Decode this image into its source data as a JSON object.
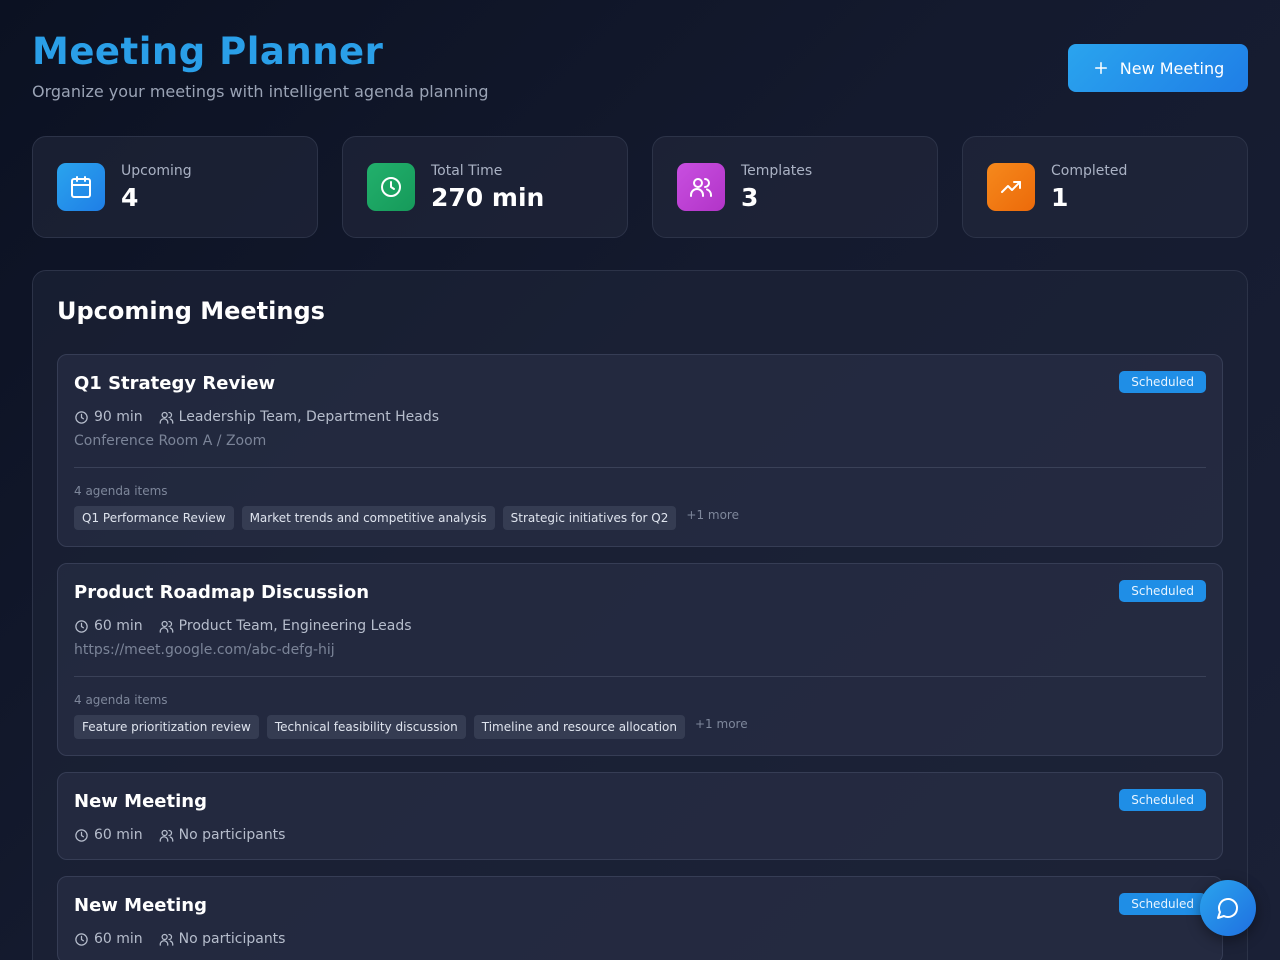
{
  "header": {
    "title": "Meeting Planner",
    "subtitle": "Organize your meetings with intelligent agenda planning",
    "new_button": "New Meeting"
  },
  "stats": [
    {
      "label": "Upcoming",
      "value": "4",
      "icon": "calendar-icon",
      "color": "#1f8fe8"
    },
    {
      "label": "Total Time",
      "value": "270 min",
      "icon": "clock-icon",
      "color": "#1ea866"
    },
    {
      "label": "Templates",
      "value": "3",
      "icon": "users-icon",
      "color": "#c044d8"
    },
    {
      "label": "Completed",
      "value": "1",
      "icon": "trending-up-icon",
      "color": "#f07a12"
    }
  ],
  "meetings_panel": {
    "title": "Upcoming Meetings",
    "meetings": [
      {
        "title": "Q1 Strategy Review",
        "status": "Scheduled",
        "duration": "90 min",
        "participants": "Leadership Team, Department Heads",
        "location": "Conference Room A / Zoom",
        "agenda_count": "4 agenda items",
        "agenda": [
          "Q1 Performance Review",
          "Market trends and competitive analysis",
          "Strategic initiatives for Q2"
        ],
        "more": "+1 more"
      },
      {
        "title": "Product Roadmap Discussion",
        "status": "Scheduled",
        "duration": "60 min",
        "participants": "Product Team, Engineering Leads",
        "location": "https://meet.google.com/abc-defg-hij",
        "agenda_count": "4 agenda items",
        "agenda": [
          "Feature prioritization review",
          "Technical feasibility discussion",
          "Timeline and resource allocation"
        ],
        "more": "+1 more"
      },
      {
        "title": "New Meeting",
        "status": "Scheduled",
        "duration": "60 min",
        "participants": "No participants"
      },
      {
        "title": "New Meeting",
        "status": "Scheduled",
        "duration": "60 min",
        "participants": "No participants"
      }
    ]
  },
  "chat_button": {
    "icon": "chat-bubble-icon"
  }
}
